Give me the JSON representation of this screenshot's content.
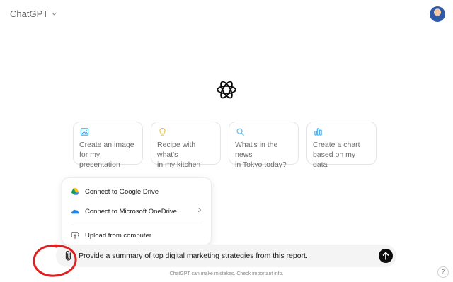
{
  "header": {
    "model_name": "ChatGPT",
    "model_chevron_icon": "chevron-down-icon",
    "avatar_icon": "user-avatar"
  },
  "logo_icon": "openai-logo-icon",
  "suggestions": [
    {
      "icon": "image-icon",
      "line1": "Create an image",
      "line2": "for my presentation",
      "color": "#35a7f0"
    },
    {
      "icon": "lightbulb-icon",
      "line1": "Recipe with what's",
      "line2": "in my kitchen",
      "color": "#e8c13b"
    },
    {
      "icon": "search-icon",
      "line1": "What's in the news",
      "line2": "in Tokyo today?",
      "color": "#5bc0eb"
    },
    {
      "icon": "bar-chart-icon",
      "line1": "Create a chart",
      "line2": "based on my data",
      "color": "#35a7f0"
    }
  ],
  "attach_menu": {
    "items": [
      {
        "label": "Connect to Google Drive",
        "icon": "google-drive-icon"
      },
      {
        "label": "Connect to Microsoft OneDrive",
        "icon": "onedrive-icon"
      },
      {
        "label": "Upload from computer",
        "icon": "upload-computer-icon"
      }
    ]
  },
  "composer": {
    "value": "Provide a summary of top digital marketing strategies from this report.",
    "attach_icon": "paperclip-icon",
    "send_icon": "arrow-up-icon"
  },
  "annotation_color": "#e02020",
  "footer": {
    "disclaimer": "ChatGPT can make mistakes. Check important info.",
    "help_label": "?"
  }
}
